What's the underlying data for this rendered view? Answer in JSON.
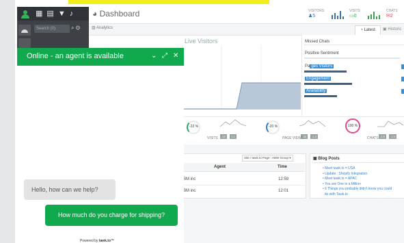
{
  "header": {
    "title": "Dashboard",
    "stats": [
      {
        "label": "VISITORS",
        "value": "5",
        "color": "#3d6fa5"
      },
      {
        "label": "VISITS",
        "value": "0",
        "color": "#3aa24a"
      },
      {
        "label": "CHATS",
        "value": "2",
        "color": "#d23a4c"
      }
    ]
  },
  "sidebar": {
    "search_placeholder": "Search (0)"
  },
  "section": {
    "breadcrumb": "Analytics",
    "tabs": [
      {
        "label": "Latest"
      },
      {
        "label": "Historic"
      }
    ]
  },
  "live": {
    "title": "Live Visitors"
  },
  "right_panel": {
    "missed_chats": "Missed Chats",
    "sentiment": "Positive Sentiment",
    "pages": [
      {
        "prefix": "Pa",
        "highlight": "ges Visitors",
        "badge": "0"
      },
      {
        "prefix": "",
        "highlight": "Engagement",
        "badge": "0"
      },
      {
        "prefix": "",
        "highlight": "Availability",
        "badge": "0"
      }
    ]
  },
  "gauges": [
    {
      "percent": "-22 %",
      "label": "VISITS",
      "mini": [
        "-14",
        "1.1"
      ]
    },
    {
      "percent": "-20 %",
      "label": "PAGE VIEWS",
      "mini": [
        "-18",
        "-1.2"
      ]
    },
    {
      "percent": "100 %",
      "label": "CHATS",
      "mini": [
        "-1.5",
        "-1.4"
      ]
    }
  ],
  "table": {
    "filter": "Site / tawk.to Page : ABW Group ▾",
    "columns": [
      "Agent",
      "Time"
    ],
    "rows": [
      {
        "agent": "BM inc",
        "time": "12:59"
      },
      {
        "agent": "BM inc",
        "time": "12:01"
      }
    ]
  },
  "blog": {
    "title": "Blog Posts",
    "items": [
      "Meet tawk.to = USA",
      "Update : Shopify Integration",
      "Meet tawk.to = APAC",
      "You are One in a Million",
      "6 Things you probably didn't know you could",
      "do with Tawk.to"
    ]
  },
  "chat": {
    "title": "Online - an agent is available",
    "messages": [
      {
        "from": "agent",
        "text": "Hello, how can we help?"
      },
      {
        "from": "visitor",
        "text": "How much do you charge for shipping?"
      }
    ],
    "powered_prefix": "Powered by",
    "powered_brand": "tawk.to™"
  },
  "colors": {
    "chat_green": "#11a94d",
    "sidebar_dark": "#3d4146",
    "accent_blue": "#3b8fd5"
  }
}
